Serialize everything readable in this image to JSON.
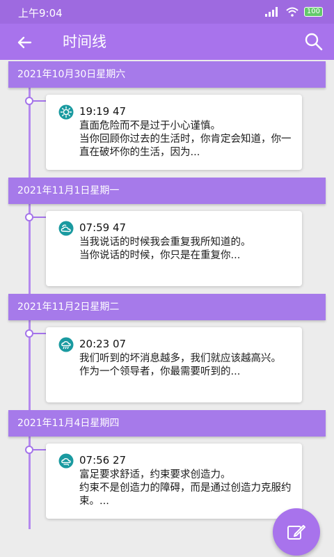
{
  "status_bar": {
    "time": "上午9:04",
    "battery": "100"
  },
  "app_bar": {
    "title": "时间线"
  },
  "timeline": [
    {
      "date": "2021年10月30日星期六",
      "time": "19:19 47",
      "weather_icon": "sunny-icon",
      "text": "直面危险而不是过于小心谨慎。\n当你回顾你过去的生活时，你肯定会知道，你一直在破坏你的生活，因为..."
    },
    {
      "date": "2021年11月1日星期一",
      "time": "07:59 47",
      "weather_icon": "partly-cloudy-icon",
      "text": "当我说话的时候我会重复我所知道的。\n当你说话的时候，你只是在重复你..."
    },
    {
      "date": "2021年11月2日星期二",
      "time": "20:23 07",
      "weather_icon": "rain-icon",
      "text": "我们听到的坏消息越多，我们就应该越高兴。\n作为一个领导者，你最需要听到的..."
    },
    {
      "date": "2021年11月4日星期四",
      "time": "07:56 27",
      "weather_icon": "windy-cloud-icon",
      "text": "富足要求舒适，约束要求创造力。\n约束不是创造力的障碍，而是通过创造力克服约束。..."
    }
  ],
  "colors": {
    "primary": "#a873ec",
    "status_bar": "#9e6ae0",
    "icon_teal": "#1a9aa0"
  }
}
